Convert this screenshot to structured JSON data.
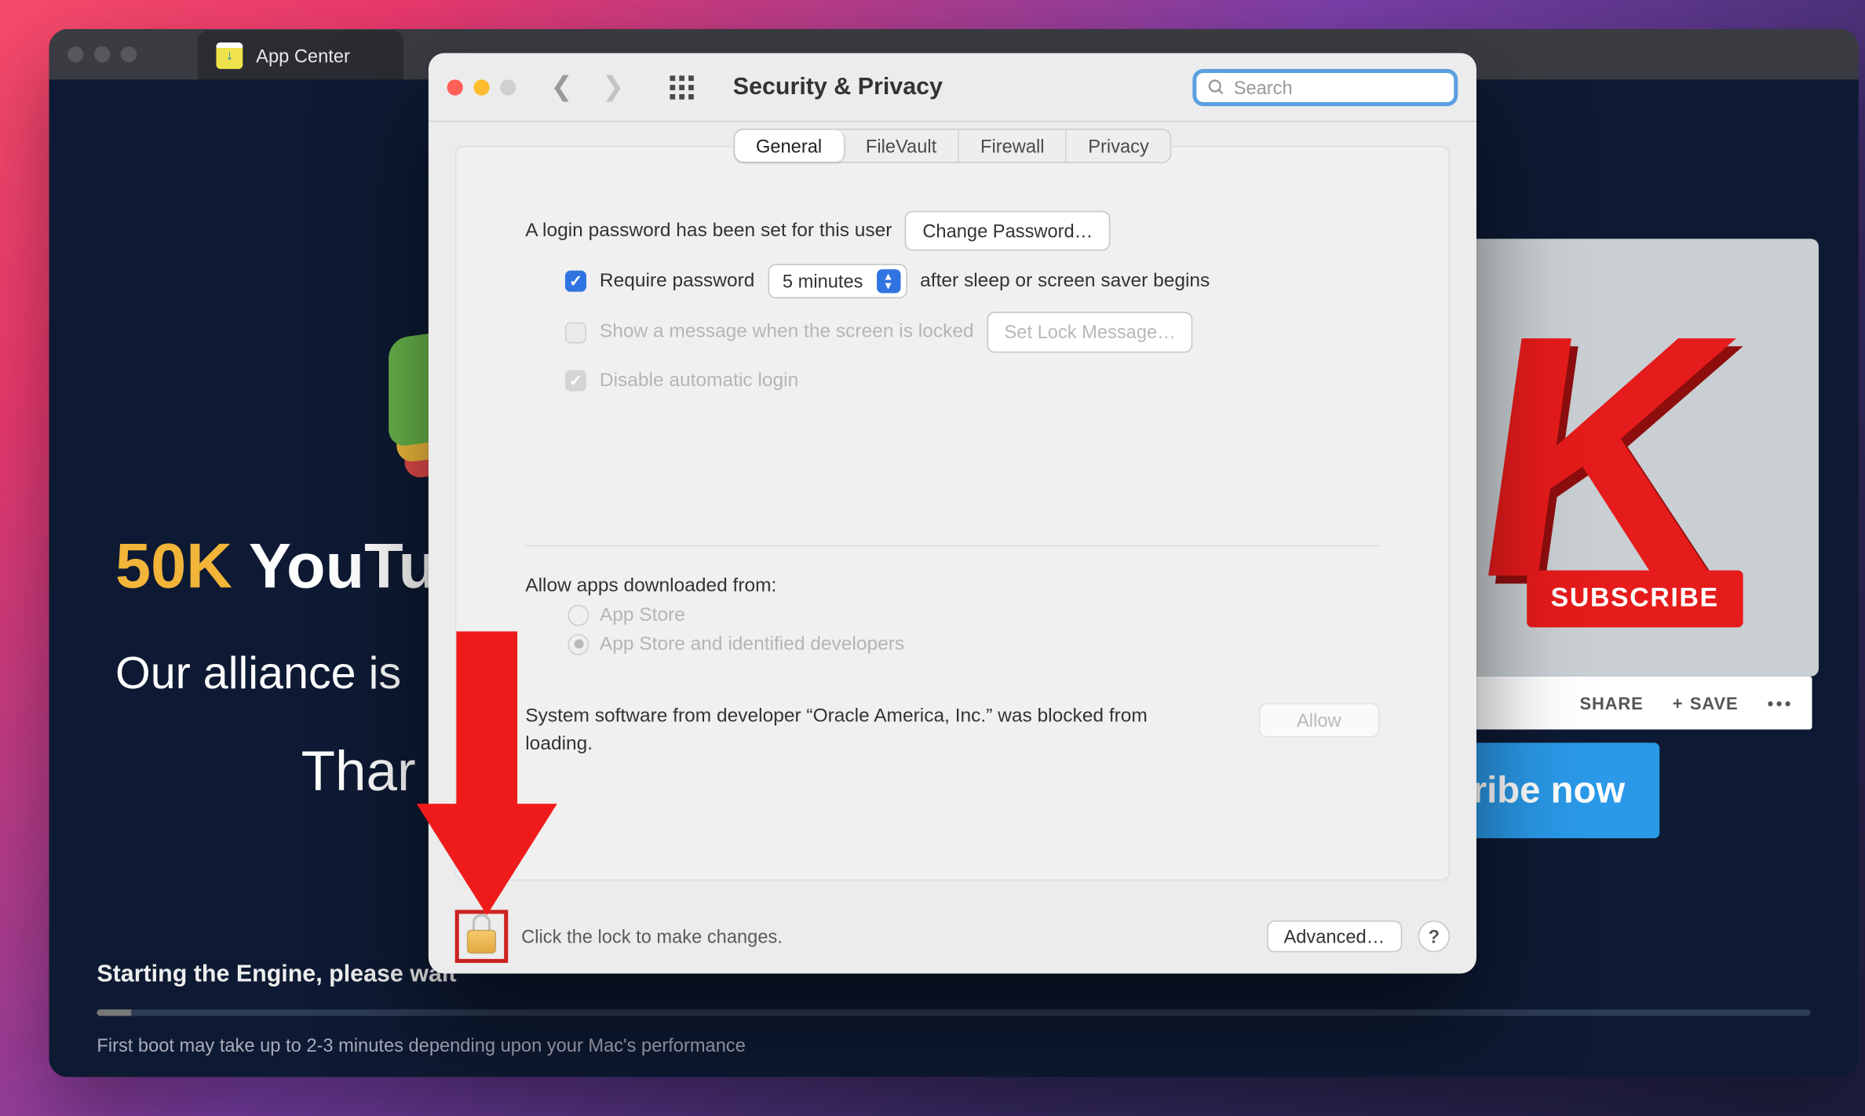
{
  "bgwindow": {
    "tab_title": "App Center",
    "promo_gold": "50K",
    "promo_rest": " YouTu",
    "promo_line2": "Our alliance is",
    "promo_line3": "Thar",
    "subscribe_badge": "SUBSCRIBE",
    "yt_share": "SHARE",
    "yt_save": "SAVE",
    "subscribe_now": "ribe now",
    "status_line1": "Starting the Engine, please wait",
    "status_line2": "First boot may take up to 2-3 minutes depending upon your Mac's performance"
  },
  "prefs": {
    "title": "Security & Privacy",
    "search_placeholder": "Search",
    "tabs": {
      "general": "General",
      "filevault": "FileVault",
      "firewall": "Firewall",
      "privacy": "Privacy"
    },
    "a": {
      "pw_set": "A login password has been set for this user",
      "change_pw": "Change Password…",
      "require_pw": "Require password",
      "delay": "5 minutes",
      "after": "after sleep or screen saver begins",
      "show_msg": "Show a message when the screen is locked",
      "set_lock_msg": "Set Lock Message…",
      "disable_auto": "Disable automatic login"
    },
    "b": {
      "lead": "Allow apps downloaded from:",
      "opt1": "App Store",
      "opt2": "App Store and identified developers"
    },
    "c": {
      "msg": "System software from developer “Oracle America, Inc.” was blocked from loading.",
      "allow": "Allow"
    },
    "footer": {
      "lock_text": "Click the lock to make changes.",
      "advanced": "Advanced…",
      "help": "?"
    }
  }
}
